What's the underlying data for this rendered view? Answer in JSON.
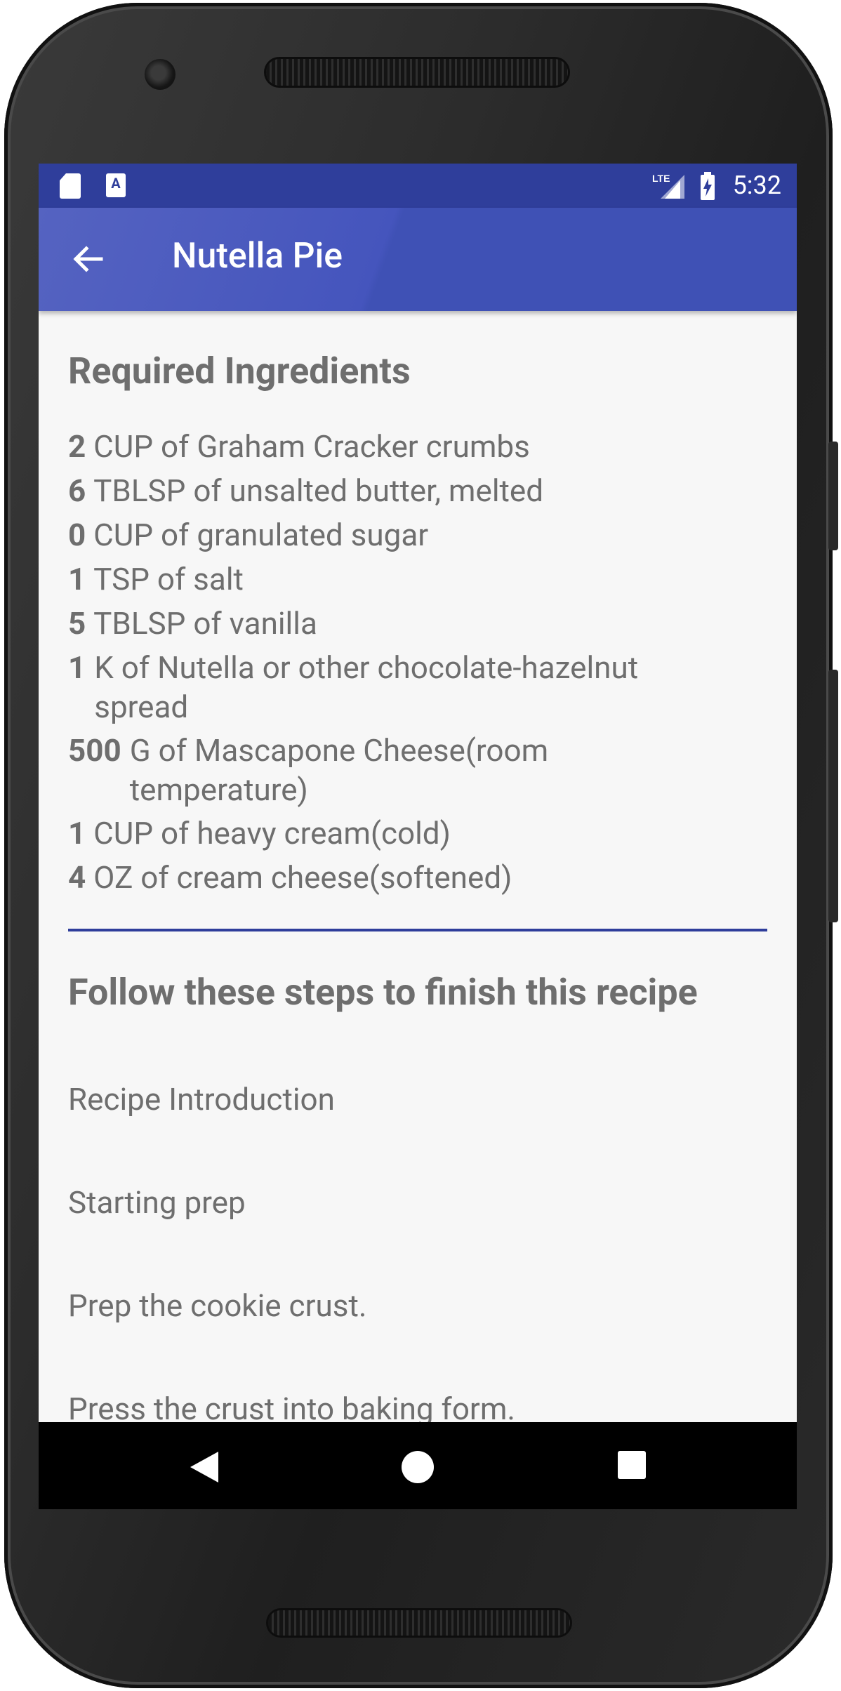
{
  "status_bar": {
    "time": "5:32",
    "network": "LTE",
    "notification_icons": [
      "sd-card-icon",
      "a-icon"
    ]
  },
  "app_bar": {
    "title": "Nutella Pie",
    "back_icon": "arrow-left-icon"
  },
  "ingredients_section": {
    "title": "Required Ingredients",
    "items": [
      {
        "qty": "2",
        "text": "CUP of Graham Cracker crumbs"
      },
      {
        "qty": "6",
        "text": "TBLSP of unsalted butter, melted"
      },
      {
        "qty": "0",
        "text": "CUP of granulated sugar"
      },
      {
        "qty": "1",
        "text": "TSP of salt"
      },
      {
        "qty": "5",
        "text": "TBLSP of vanilla"
      },
      {
        "qty": "1",
        "text": "K of Nutella or other chocolate-hazelnut spread"
      },
      {
        "qty": "500",
        "text": "G of Mascapone Cheese(room temperature)"
      },
      {
        "qty": "1",
        "text": "CUP of heavy cream(cold)"
      },
      {
        "qty": "4",
        "text": "OZ of cream cheese(softened)"
      }
    ]
  },
  "steps_section": {
    "title": "Follow these steps to finish this recipe",
    "steps": [
      "Recipe Introduction",
      "Starting prep",
      "Prep the cookie crust.",
      "Press the crust into baking form."
    ]
  },
  "nav_bar": {
    "buttons": [
      "back-triangle-icon",
      "home-circle-icon",
      "recents-square-icon"
    ]
  },
  "colors": {
    "primary": "#3f51b5",
    "primary_dark": "#2f3e9b",
    "text": "#6e6e6e",
    "background": "#f7f7f7"
  }
}
